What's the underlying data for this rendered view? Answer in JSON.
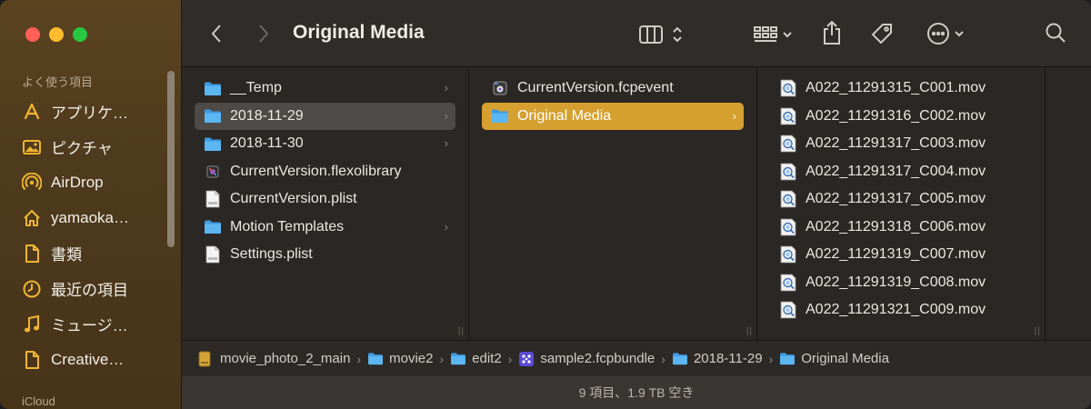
{
  "window": {
    "title": "Original Media"
  },
  "sidebar": {
    "section_favorites": "よく使う項目",
    "section_icloud": "iCloud",
    "items": [
      {
        "label": "アプリケ…",
        "icon": "applications-icon"
      },
      {
        "label": "ピクチャ",
        "icon": "pictures-icon"
      },
      {
        "label": "AirDrop",
        "icon": "airdrop-icon"
      },
      {
        "label": "yamaoka…",
        "icon": "home-icon"
      },
      {
        "label": "書類",
        "icon": "document-icon"
      },
      {
        "label": "最近の項目",
        "icon": "clock-icon"
      },
      {
        "label": "ミュージ…",
        "icon": "music-icon"
      },
      {
        "label": "Creative…",
        "icon": "document-icon"
      }
    ]
  },
  "columns": [
    {
      "items": [
        {
          "name": "__Temp",
          "type": "folder",
          "chevron": true
        },
        {
          "name": "2018-11-29",
          "type": "folder",
          "chevron": true,
          "selected": "gray"
        },
        {
          "name": "2018-11-30",
          "type": "folder",
          "chevron": true
        },
        {
          "name": "CurrentVersion.flexolibrary",
          "type": "flexo"
        },
        {
          "name": "CurrentVersion.plist",
          "type": "plist"
        },
        {
          "name": "Motion Templates",
          "type": "folder",
          "chevron": true
        },
        {
          "name": "Settings.plist",
          "type": "plist"
        }
      ]
    },
    {
      "items": [
        {
          "name": "CurrentVersion.fcpevent",
          "type": "fcpevent"
        },
        {
          "name": "Original Media",
          "type": "folder",
          "chevron": true,
          "selected": "gold"
        }
      ]
    },
    {
      "items": [
        {
          "name": "A022_11291315_C001.mov",
          "type": "movie"
        },
        {
          "name": "A022_11291316_C002.mov",
          "type": "movie"
        },
        {
          "name": "A022_11291317_C003.mov",
          "type": "movie"
        },
        {
          "name": "A022_11291317_C004.mov",
          "type": "movie"
        },
        {
          "name": "A022_11291317_C005.mov",
          "type": "movie"
        },
        {
          "name": "A022_11291318_C006.mov",
          "type": "movie"
        },
        {
          "name": "A022_11291319_C007.mov",
          "type": "movie"
        },
        {
          "name": "A022_11291319_C008.mov",
          "type": "movie"
        },
        {
          "name": "A022_11291321_C009.mov",
          "type": "movie"
        }
      ]
    }
  ],
  "pathbar": [
    {
      "label": "movie_photo_2_main",
      "type": "drive"
    },
    {
      "label": "movie2",
      "type": "folder"
    },
    {
      "label": "edit2",
      "type": "folder"
    },
    {
      "label": "sample2.fcpbundle",
      "type": "bundle"
    },
    {
      "label": "2018-11-29",
      "type": "folder"
    },
    {
      "label": "Original Media",
      "type": "folder"
    }
  ],
  "status": {
    "text": "9 項目、1.9 TB 空き"
  },
  "colors": {
    "accent_gold": "#d5a02f",
    "folder_blue": "#4aa8ea",
    "sidebar_icon": "#f1b531"
  }
}
